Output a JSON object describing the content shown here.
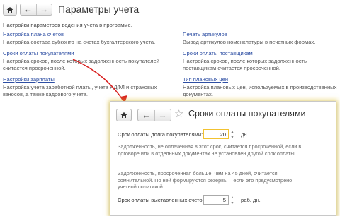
{
  "main": {
    "title": "Параметры учета",
    "subtitle": "Настройки параметров ведения учета в программе.",
    "left_items": [
      {
        "link": "Настройка плана счетов",
        "desc": "Настройка состава субконто на счетах бухгалтерского учета."
      },
      {
        "link": "Сроки оплаты покупателями",
        "desc": "Настройка сроков, после которых задолженность покупателей считается просроченной."
      },
      {
        "link": "Настройки зарплаты",
        "desc": "Настройка учета заработной платы, учета НДФЛ и страховых взносов, а также кадрового учета."
      }
    ],
    "right_items": [
      {
        "link": "Печать артикулов",
        "desc": "Вывод артикулов номенклатуры в печатных формах."
      },
      {
        "link": "Сроки оплаты поставщикам",
        "desc": "Настройка сроков, после которых задолженность поставщикам считается просроченной."
      },
      {
        "link": "Тип плановых цен",
        "desc": "Настройка плановых цен, используемых в производственных документах."
      }
    ]
  },
  "popup": {
    "title": "Сроки оплаты покупателями",
    "field1": {
      "label": "Срок оплаты долга покупателями:",
      "value": "20",
      "unit": "дн."
    },
    "note1": "Задолженность, не оплаченная в этот срок, считается просроченной, если в договоре или в отдельных документах не установлен другой срок оплаты.",
    "note2": "Задолженность, просроченная больше, чем на 45 дней, считается сомнительной. По ней формируются резервы – если это предусмотрено учетной политикой.",
    "field2": {
      "label": "Срок оплаты выставленных счетов:",
      "value": "5",
      "unit": "раб. дн."
    }
  },
  "icons": {
    "home": "home-icon",
    "back": "arrow-left-icon",
    "forward": "arrow-right-icon",
    "favorite": "star-icon"
  },
  "colors": {
    "link": "#2d4ea3",
    "active_field_border": "#f2c230",
    "callout_arrow": "#d81e1e"
  }
}
